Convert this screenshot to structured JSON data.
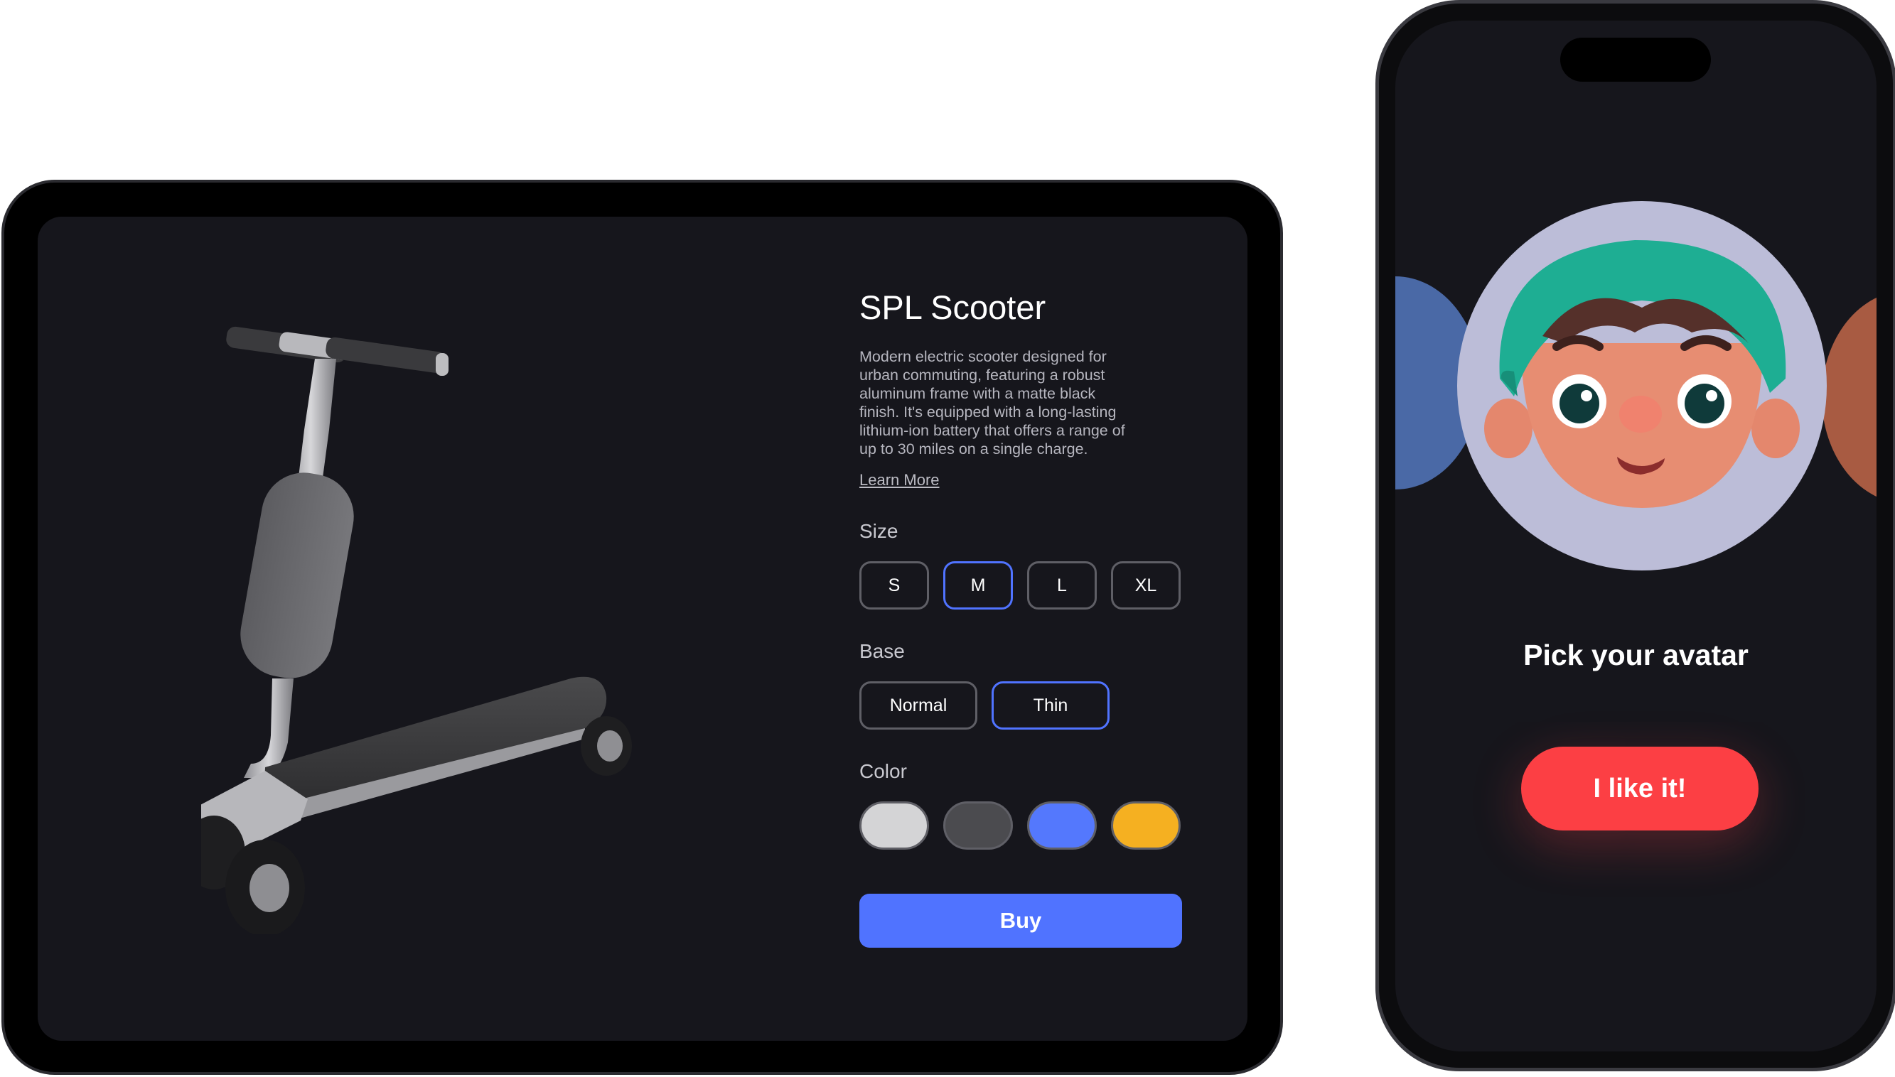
{
  "tablet": {
    "product": {
      "title": "SPL Scooter",
      "description": "Modern electric scooter designed for urban commuting, featuring a robust aluminum frame with a matte black finish. It's equipped with a long-lasting lithium-ion battery that offers a range of up to 30 miles on a single charge.",
      "learn_more": "Learn More",
      "size": {
        "label": "Size",
        "options": [
          "S",
          "M",
          "L",
          "XL"
        ],
        "selected": "M"
      },
      "base": {
        "label": "Base",
        "options": [
          "Normal",
          "Thin"
        ],
        "selected": "Thin"
      },
      "color": {
        "label": "Color",
        "swatches": [
          "#d4d4d6",
          "#4b4b4f",
          "#5478fd",
          "#f5b021"
        ]
      },
      "buy_label": "Buy"
    },
    "accent": "#5073ff"
  },
  "phone": {
    "title": "Pick your avatar",
    "button_label": "I like it!",
    "button_color": "#fc3f44"
  }
}
